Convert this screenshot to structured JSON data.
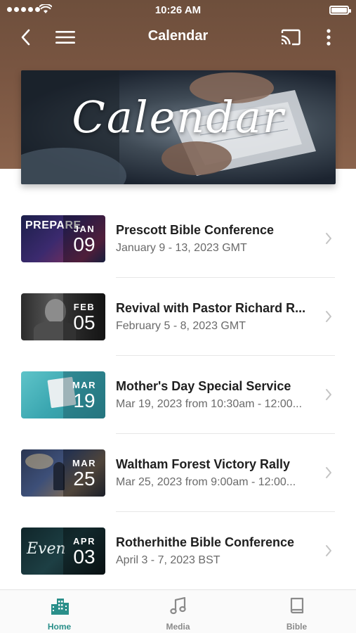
{
  "status_bar": {
    "time": "10:26 AM"
  },
  "nav": {
    "title": "Calendar"
  },
  "banner": {
    "text": "Calendar"
  },
  "events": [
    {
      "month": "JAN",
      "day": "09",
      "title": "Prescott Bible Conference",
      "date": "January 9 - 13, 2023 GMT",
      "thumb_text": "PREPARE"
    },
    {
      "month": "FEB",
      "day": "05",
      "title": "Revival with Pastor Richard R...",
      "date": "February 5 - 8, 2023 GMT"
    },
    {
      "month": "MAR",
      "day": "19",
      "title": "Mother's Day Special Service",
      "date": "Mar 19, 2023 from 10:30am - 12:00..."
    },
    {
      "month": "MAR",
      "day": "25",
      "title": "Waltham Forest Victory Rally",
      "date": "Mar 25, 2023 from 9:00am - 12:00..."
    },
    {
      "month": "APR",
      "day": "03",
      "title": "Rotherhithe Bible Conference",
      "date": "April 3 - 7, 2023 BST",
      "thumb_text": "Even"
    }
  ],
  "tabs": [
    {
      "label": "Home",
      "icon": "home-icon",
      "active": true
    },
    {
      "label": "Media",
      "icon": "music-note-icon",
      "active": false
    },
    {
      "label": "Bible",
      "icon": "book-icon",
      "active": false
    }
  ],
  "colors": {
    "accent": "#2a8f8a",
    "header": "#7a5642"
  }
}
